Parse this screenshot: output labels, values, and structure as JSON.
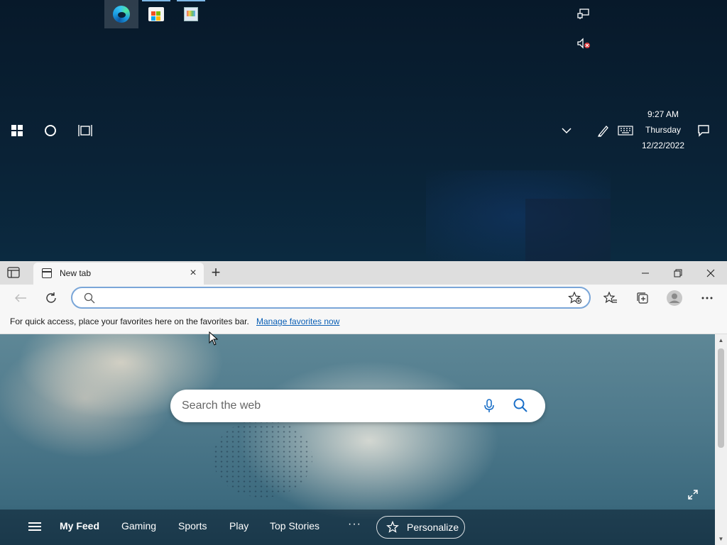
{
  "taskbar": {
    "pinned": [
      {
        "name": "Microsoft Edge",
        "icon": "edge-icon",
        "active": true
      },
      {
        "name": "Microsoft Store",
        "icon": "store-icon",
        "active": false
      },
      {
        "name": "Paint",
        "icon": "paint-icon",
        "active": false
      }
    ],
    "system_icons": [
      "network-icon",
      "volume-muted-icon",
      "chevron-up-icon",
      "pen-icon",
      "touch-keyboard-icon",
      "notifications-icon"
    ],
    "clock": {
      "time": "9:27 AM",
      "day": "Thursday",
      "date": "12/22/2022"
    },
    "start_icon": "windows-logo-icon",
    "search_icon": "cortana-circle-icon",
    "taskview_icon": "task-view-icon"
  },
  "browser": {
    "tab": {
      "title": "New tab",
      "close_label": "×"
    },
    "new_tab_label": "+",
    "window_controls": {
      "minimize": "—",
      "restore": "❐",
      "close": "✕"
    },
    "address": {
      "value": "",
      "placeholder": ""
    },
    "favorites_bar": {
      "text": "For quick access, place your favorites here on the favorites bar.",
      "link": "Manage favorites now"
    },
    "colors": {
      "accent": "#0a5fb5",
      "address_border": "#7aa6d8",
      "tabstrip": "#dedede"
    }
  },
  "ntp": {
    "search": {
      "placeholder": "Search the web"
    },
    "feed": {
      "items": [
        "My Feed",
        "Gaming",
        "Sports",
        "Play",
        "Top Stories"
      ],
      "active": "My Feed",
      "more_label": "···",
      "personalize_label": "Personalize"
    }
  }
}
